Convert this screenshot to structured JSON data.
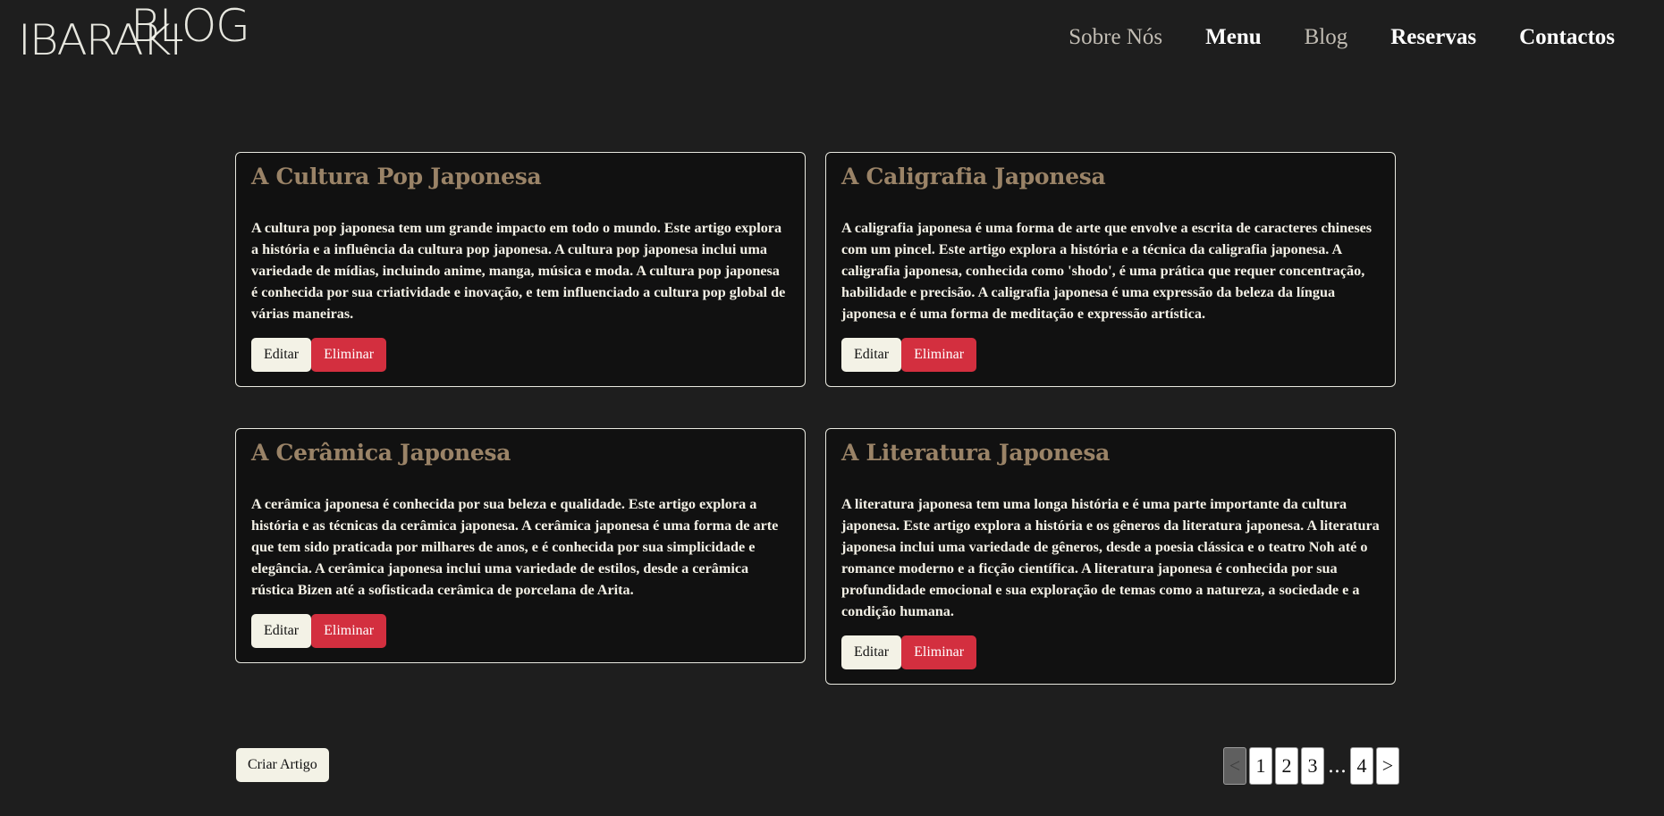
{
  "brand": {
    "logo_main": "IBARAKI",
    "logo_overlay": "BLOG"
  },
  "nav": {
    "items": [
      {
        "label": "Sobre Nós"
      },
      {
        "label": "Menu"
      },
      {
        "label": "Blog"
      },
      {
        "label": "Reservas"
      },
      {
        "label": "Contactos"
      }
    ]
  },
  "articles": [
    {
      "title": "A Cultura Pop Japonesa",
      "text": "A cultura pop japonesa tem um grande impacto em todo o mundo. Este artigo explora a história e a influência da cultura pop japonesa. A cultura pop japonesa inclui uma variedade de mídias, incluindo anime, manga, música e moda. A cultura pop japonesa é conhecida por sua criatividade e inovação, e tem influenciado a cultura pop global de várias maneiras.",
      "edit_label": "Editar",
      "delete_label": "Eliminar"
    },
    {
      "title": "A Caligrafia Japonesa",
      "text": "A caligrafia japonesa é uma forma de arte que envolve a escrita de caracteres chineses com um pincel. Este artigo explora a história e a técnica da caligrafia japonesa. A caligrafia japonesa, conhecida como 'shodo', é uma prática que requer concentração, habilidade e precisão. A caligrafia japonesa é uma expressão da beleza da língua japonesa e é uma forma de meditação e expressão artística.",
      "edit_label": "Editar",
      "delete_label": "Eliminar"
    },
    {
      "title": "A Cerâmica Japonesa",
      "text": "A cerâmica japonesa é conhecida por sua beleza e qualidade. Este artigo explora a história e as técnicas da cerâmica japonesa. A cerâmica japonesa é uma forma de arte que tem sido praticada por milhares de anos, e é conhecida por sua simplicidade e elegância. A cerâmica japonesa inclui uma variedade de estilos, desde a cerâmica rústica Bizen até a sofisticada cerâmica de porcelana de Arita.",
      "edit_label": "Editar",
      "delete_label": "Eliminar"
    },
    {
      "title": "A Literatura Japonesa",
      "text": "A literatura japonesa tem uma longa história e é uma parte importante da cultura japonesa. Este artigo explora a história e os gêneros da literatura japonesa. A literatura japonesa inclui uma variedade de gêneros, desde a poesia clássica e o teatro Noh até o romance moderno e a ficção científica. A literatura japonesa é conhecida por sua profundidade emocional e sua exploração de temas como a natureza, a sociedade e a condição humana.",
      "edit_label": "Editar",
      "delete_label": "Eliminar"
    }
  ],
  "footer": {
    "create_label": "Criar Artigo",
    "pagination": {
      "prev": "<",
      "pages": [
        "1",
        "2",
        "3"
      ],
      "ellipsis": "...",
      "last": "4",
      "next": ">"
    }
  },
  "colors": {
    "background": "#1e1e1e",
    "card": "#111111",
    "title": "#9a8367",
    "delete": "#d32f3f",
    "light_button": "#f3f2e6"
  }
}
